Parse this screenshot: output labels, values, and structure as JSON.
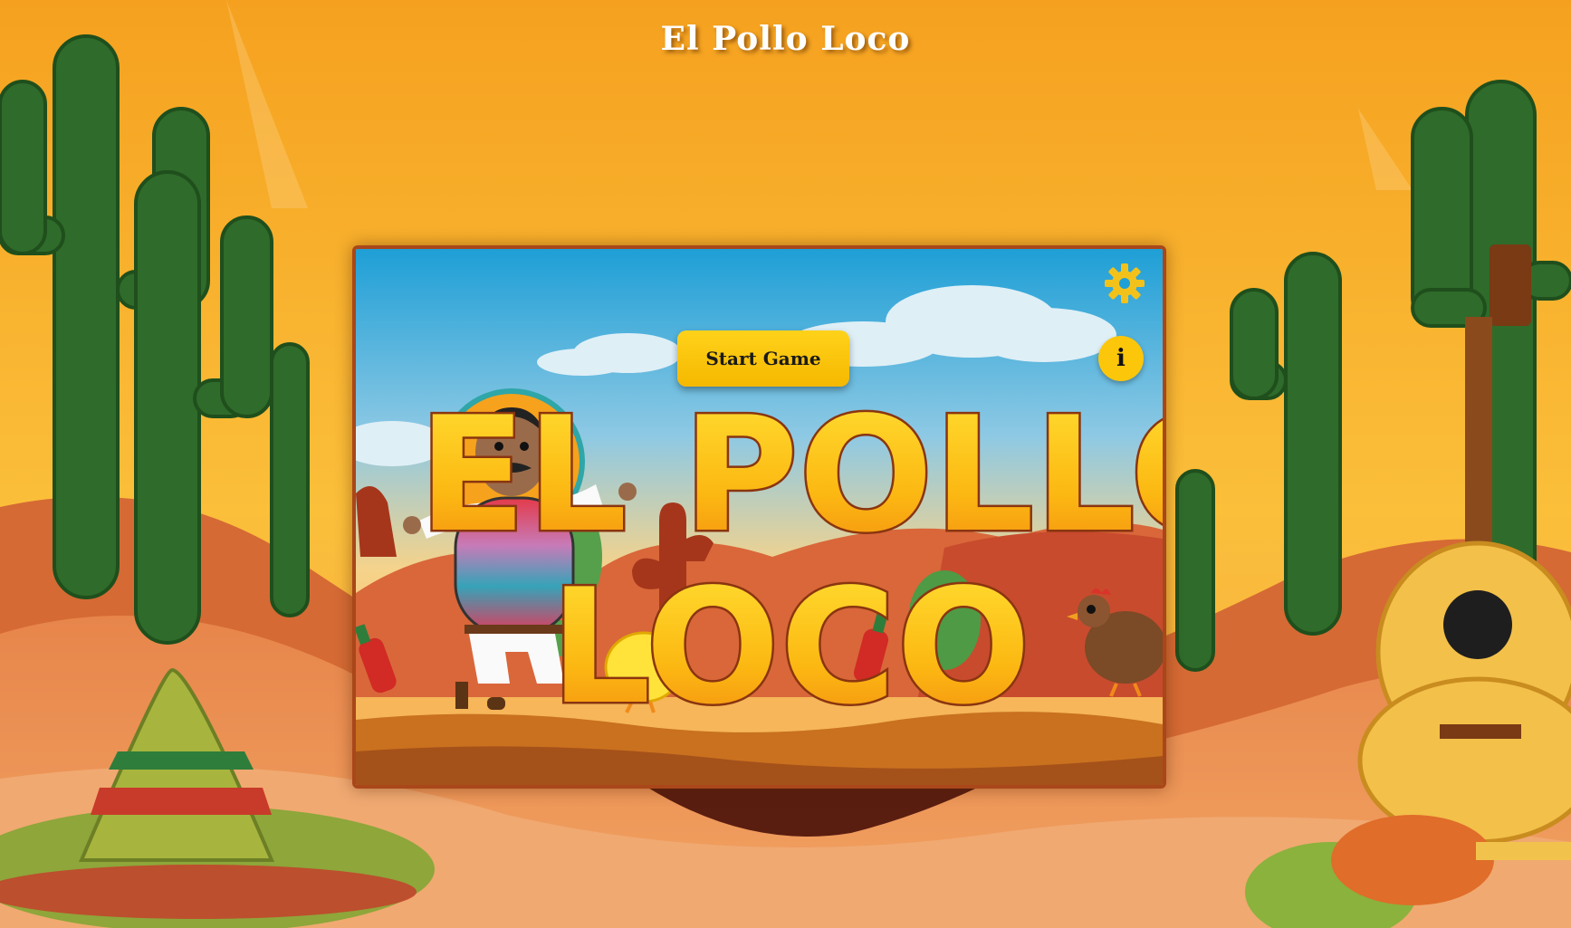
{
  "page": {
    "title": "El Pollo Loco"
  },
  "game": {
    "logo_line1": "EL POLLO",
    "logo_line2": "LOCO",
    "start_button_label": "Start Game",
    "info_button_label": "i",
    "settings_icon": "gear-icon"
  },
  "colors": {
    "background_orange": "#f6a623",
    "button_yellow": "#fcc60b",
    "frame_border": "#a9471a",
    "cactus_green": "#2f6b2a",
    "sky_blue": "#1ea0d6"
  }
}
